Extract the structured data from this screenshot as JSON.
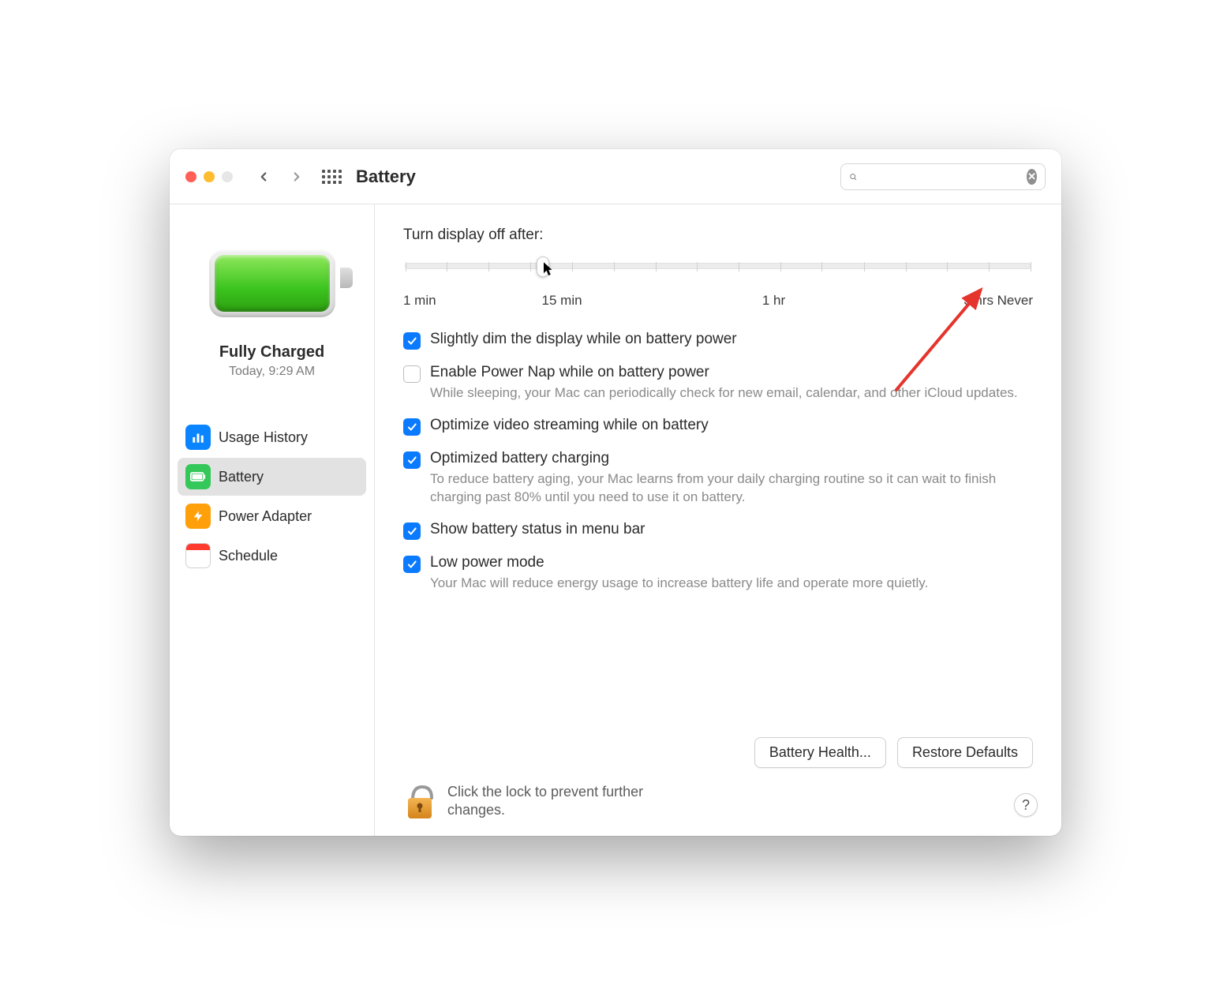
{
  "window": {
    "title": "Battery"
  },
  "search": {
    "placeholder": ""
  },
  "sidebar": {
    "status_title": "Fully Charged",
    "status_sub": "Today, 9:29 AM",
    "items": [
      {
        "label": "Usage History",
        "icon": "chart-icon",
        "color": "ic-blue",
        "selected": false
      },
      {
        "label": "Battery",
        "icon": "battery-icon",
        "color": "ic-green",
        "selected": true
      },
      {
        "label": "Power Adapter",
        "icon": "bolt-icon",
        "color": "ic-orange",
        "selected": false
      },
      {
        "label": "Schedule",
        "icon": "calendar-icon",
        "color": "ic-cal",
        "selected": false
      }
    ]
  },
  "slider": {
    "title": "Turn display off after:",
    "value_percent": 21,
    "labels": {
      "l0": "1 min",
      "l1": "15 min",
      "l2": "1 hr",
      "l3": "3 hrs",
      "l4": "Never"
    }
  },
  "options": [
    {
      "checked": true,
      "label": "Slightly dim the display while on battery power",
      "desc": ""
    },
    {
      "checked": false,
      "label": "Enable Power Nap while on battery power",
      "desc": "While sleeping, your Mac can periodically check for new email, calendar, and other iCloud updates."
    },
    {
      "checked": true,
      "label": "Optimize video streaming while on battery",
      "desc": ""
    },
    {
      "checked": true,
      "label": "Optimized battery charging",
      "desc": "To reduce battery aging, your Mac learns from your daily charging routine so it can wait to finish charging past 80% until you need to use it on battery."
    },
    {
      "checked": true,
      "label": "Show battery status in menu bar",
      "desc": ""
    },
    {
      "checked": true,
      "label": "Low power mode",
      "desc": "Your Mac will reduce energy usage to increase battery life and operate more quietly."
    }
  ],
  "buttons": {
    "battery_health": "Battery Health...",
    "restore_defaults": "Restore Defaults"
  },
  "lock": {
    "text": "Click the lock to prevent further changes."
  },
  "help": {
    "label": "?"
  }
}
